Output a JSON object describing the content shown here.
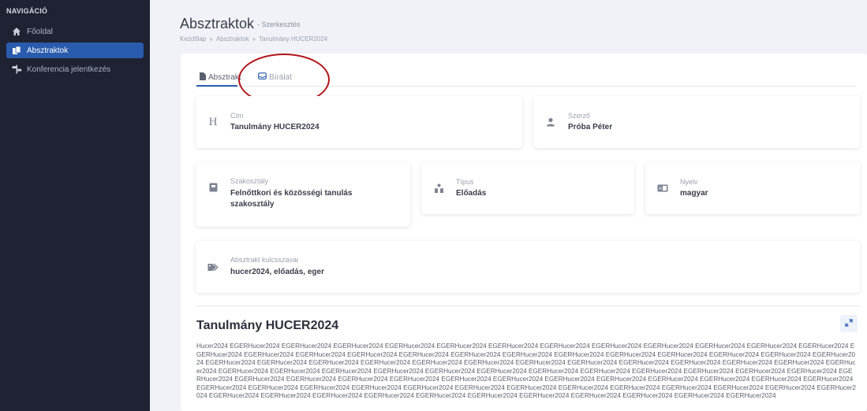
{
  "sidebar": {
    "heading": "NAVIGÁCIÓ",
    "items": [
      {
        "label": "Főoldal",
        "icon": "home-icon"
      },
      {
        "label": "Absztraktok",
        "icon": "documents-icon",
        "active": true
      },
      {
        "label": "Konferencia jelentkezés",
        "icon": "signpost-icon"
      }
    ]
  },
  "header": {
    "title": "Absztraktok",
    "subtitle": "- Szerkesztés",
    "breadcrumb": [
      "Kezdőlap",
      "»",
      "Absztraktok",
      "»",
      "Tanulmány HUCER2024"
    ]
  },
  "tabs": [
    {
      "label": "Absztrakt",
      "icon": "document-icon",
      "active": true
    },
    {
      "label": "Bírálat",
      "icon": "inbox-icon"
    }
  ],
  "cards": {
    "cim": {
      "label": "Cím",
      "value": "Tanulmány HUCER2024",
      "icon": "heading-icon"
    },
    "szerzo": {
      "label": "Szerző",
      "value": "Próba Péter",
      "icon": "user-icon"
    },
    "szakosztaly": {
      "label": "Szakosztály",
      "value": "Felnőttkori és közösségi tanulás szakosztály",
      "icon": "book-icon"
    },
    "tipus": {
      "label": "Típus",
      "value": "Előadás",
      "icon": "presentation-icon"
    },
    "nyelv": {
      "label": "Nyelv",
      "value": "magyar",
      "icon": "language-icon"
    },
    "kulcsszavak": {
      "label": "Absztrakt kulcsszavai",
      "value": "hucer2024, előadás, eger",
      "icon": "tags-icon"
    }
  },
  "document": {
    "title": "Tanulmány HUCER2024",
    "body": "Hucer2024 EGERHucer2024 EGERHucer2024 EGERHucer2024 EGERHucer2024 EGERHucer2024 EGERHucer2024 EGERHucer2024 EGERHucer2024 EGERHucer2024 EGERHucer2024 EGERHucer2024 EGERHucer2024 EGERHucer2024 EGERHucer2024 EGERHucer2024 EGERHucer2024 EGERHucer2024 EGERHucer2024 EGERHucer2024 EGERHucer2024 EGERHucer2024 EGERHucer2024 EGERHucer2024 EGERHucer2024 EGERHucer2024 EGERHucer2024 EGERHucer2024 EGERHucer2024 EGERHucer2024 EGERHucer2024 EGERHucer2024 EGERHucer2024 EGERHucer2024 EGERHucer2024 EGERHucer2024 EGERHucer2024 EGERHucer2024 EGERHucer2024 EGERHucer2024 EGERHucer2024 EGERHucer2024 EGERHucer2024 EGERHucer2024 EGERHucer2024 EGERHucer2024 EGERHucer2024 EGERHucer2024 EGERHucer2024 EGERHucer2024 EGERHucer2024 EGERHucer2024 EGERHucer2024 EGERHucer2024 EGERHucer2024 EGERHucer2024 EGERHucer2024 EGERHucer2024 EGERHucer2024 EGERHucer2024 EGERHucer2024 EGERHucer2024 EGERHucer2024 EGERHucer2024 EGERHucer2024 EGERHucer2024 EGERHucer2024 EGERHucer2024 EGERHucer2024 EGERHucer2024 EGERHucer2024 EGERHucer2024 EGERHucer2024 EGERHucer2024 EGERHucer2024 EGERHucer2024 EGERHucer2024 EGERHucer2024 EGERHucer2024 EGERHucer2024 EGERHucer2024 EGERHucer2024 EGERHucer2024 EGERHucer2024 EGERHucer2024 EGERHucer2024 EGERHucer2024 EGERHucer2024"
  },
  "colors": {
    "sidebar_bg": "#1e2233",
    "accent": "#2a5cad",
    "annotation": "#b0161c"
  }
}
